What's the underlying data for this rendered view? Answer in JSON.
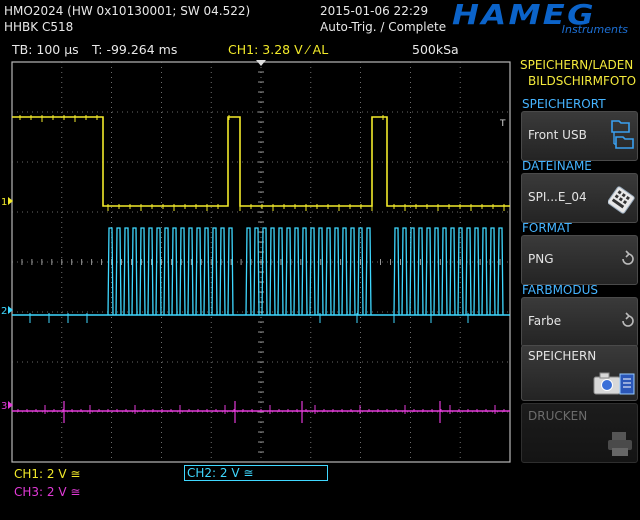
{
  "header": {
    "device": "HMO2024 (HW 0x10130001; SW 04.522)",
    "serial": "HHBK C518",
    "datetime": "2015-01-06 22:29",
    "trigger_status": "Auto-Trig. / Complete"
  },
  "logo": {
    "brand": "HAMEG",
    "sub": "Instruments"
  },
  "status_bar": {
    "timebase": "TB: 100 µs",
    "trigger_time": "T: -99.264 ms",
    "ch1_trigger": "CH1: 3.28 V ⁄ AL",
    "sample_rate": "500kSa"
  },
  "colors": {
    "ch1": "#f2ea2a",
    "ch2": "#3fd8ff",
    "ch3": "#e23ad8",
    "menu_title": "#46b4ff",
    "accent": "#f4ea3c"
  },
  "side_menu": {
    "title_line1": "SPEICHERN/LADEN",
    "title_line2": "BILDSCHIRMFOTO",
    "items": [
      {
        "title": "SPEICHERORT",
        "value": "Front USB",
        "icon": "usb-folder-icon"
      },
      {
        "title": "DATEINAME",
        "value": "SPI...E_04",
        "icon": "keyboard-icon"
      },
      {
        "title": "FORMAT",
        "value": "PNG",
        "icon": "cycle-arrow-icon"
      },
      {
        "title": "FARBMODUS",
        "value": "Farbe",
        "icon": "cycle-arrow-icon"
      },
      {
        "title": "",
        "value": "SPEICHERN",
        "icon": "camera-save-icon"
      },
      {
        "title": "",
        "value": "DRUCKEN",
        "icon": "printer-icon"
      }
    ]
  },
  "channels": [
    {
      "label": "CH1: 2 V ≅",
      "marker": "1"
    },
    {
      "label": "CH2: 2 V ≅",
      "marker": "2"
    },
    {
      "label": "CH3: 2 V ≅",
      "marker": "3"
    }
  ],
  "trigger_marker": "T"
}
